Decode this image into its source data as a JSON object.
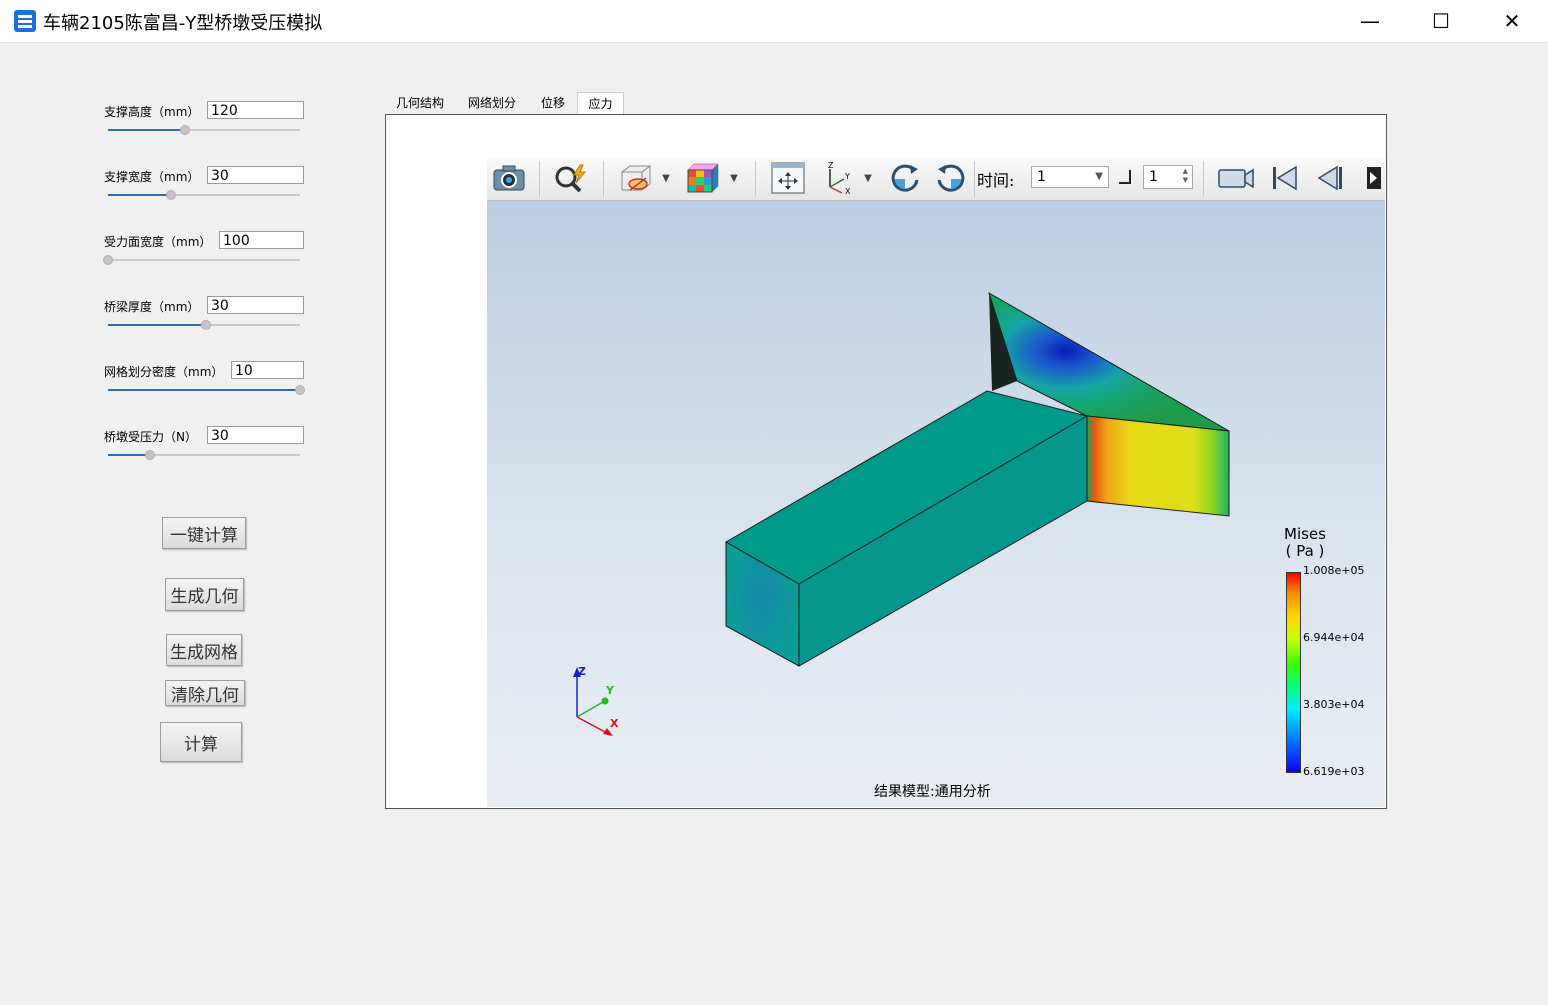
{
  "window": {
    "title": "车辆2105陈富昌-Y型桥墩受压模拟",
    "minimize": "—",
    "maximize": "☐",
    "close": "✕"
  },
  "params": [
    {
      "label": "支撑高度（mm）",
      "value": "120",
      "level": 0.4
    },
    {
      "label": "支撑宽度（mm）",
      "value": "30",
      "level": 0.33
    },
    {
      "label": "受力面宽度（mm）",
      "value": "100",
      "level": 0.0
    },
    {
      "label": "桥梁厚度（mm）",
      "value": "30",
      "level": 0.51
    },
    {
      "label": "网格划分密度（mm）",
      "value": "10",
      "level": 1.0
    },
    {
      "label": "桥墩受压力（N）",
      "value": "30",
      "level": 0.22
    }
  ],
  "buttons": {
    "one_click": "一键计算",
    "gen_geometry": "生成几何",
    "gen_mesh": "生成网格",
    "clear_geometry": "清除几何",
    "compute": "计算"
  },
  "tabs": [
    "几何结构",
    "网络划分",
    "位移",
    "应力"
  ],
  "active_tab": 3,
  "toolbar": {
    "time_label": "时间:",
    "time_value": "1",
    "frame_value": "1"
  },
  "legend": {
    "title_line1": "Mises",
    "title_line2": "( Pa )",
    "ticks": [
      "1.008e+05",
      "6.944e+04",
      "3.803e+04",
      "6.619e+03"
    ]
  },
  "axes": {
    "z": "Z",
    "y": "Y",
    "x": "X"
  },
  "caption": "结果模型:通用分析",
  "colors": {
    "accent": "#2f6bb5",
    "model_base": "#009a8a"
  }
}
